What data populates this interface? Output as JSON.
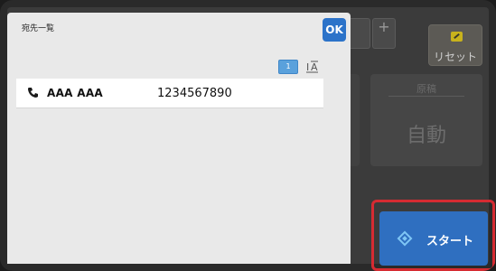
{
  "dialog": {
    "title": "宛先一覧",
    "ok_label": "OK",
    "page_number": "1",
    "sort_icon": "sort-icon",
    "entries": [
      {
        "type_icon": "phone-icon",
        "name": "AAA AAA",
        "number": "1234567890"
      }
    ]
  },
  "background": {
    "reset_label": "リセット",
    "reset_icon": "eraser-icon",
    "plus_glyph": "+",
    "original_label": "原稿",
    "original_value": "自動"
  },
  "start": {
    "label": "スタート",
    "icon": "start-diamond-icon",
    "highlight_color": "#d62b32",
    "button_color": "#2f6fc0"
  },
  "colors": {
    "ok_button": "#2c73c9",
    "page_indicator": "#5aa1dc"
  }
}
